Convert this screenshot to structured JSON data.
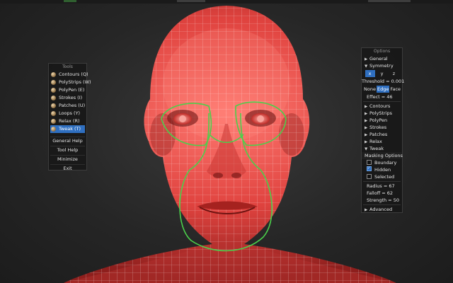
{
  "tools_panel": {
    "title": "Tools",
    "items": [
      {
        "label": "Contours (Q)",
        "active": false
      },
      {
        "label": "PolyStrips (W)",
        "active": false
      },
      {
        "label": "PolyPen (E)",
        "active": false
      },
      {
        "label": "Strokes (I)",
        "active": false
      },
      {
        "label": "Patches (U)",
        "active": false
      },
      {
        "label": "Loops (Y)",
        "active": false
      },
      {
        "label": "Relax (R)",
        "active": false
      },
      {
        "label": "Tweak (T)",
        "active": true
      }
    ],
    "buttons": [
      "General Help",
      "Tool Help",
      "Minimize",
      "Exit"
    ]
  },
  "options_panel": {
    "title": "Options",
    "general": "General",
    "symmetry": "Symmetry",
    "axes": [
      "x",
      "y",
      "z"
    ],
    "threshold": "Threshold = 0.001",
    "display_modes": [
      "None",
      "Edge",
      "Face"
    ],
    "effect": "Effect = 46",
    "sections": [
      "Contours",
      "PolyStrips",
      "PolyPen",
      "Strokes",
      "Patches",
      "Relax",
      "Tweak"
    ],
    "masking_title": "Masking Options",
    "masking": [
      {
        "label": "Boundary",
        "checked": false
      },
      {
        "label": "Hidden",
        "checked": true
      },
      {
        "label": "Selected",
        "checked": false
      }
    ],
    "radius": "Radius = 67",
    "falloff": "Falloff = 62",
    "strength": "Strength = 50",
    "advanced": "Advanced"
  },
  "colors": {
    "accent": "#2f6fc0",
    "mesh": "#e0433f",
    "wire": "#ffffff",
    "selection": "#4bd04b"
  }
}
